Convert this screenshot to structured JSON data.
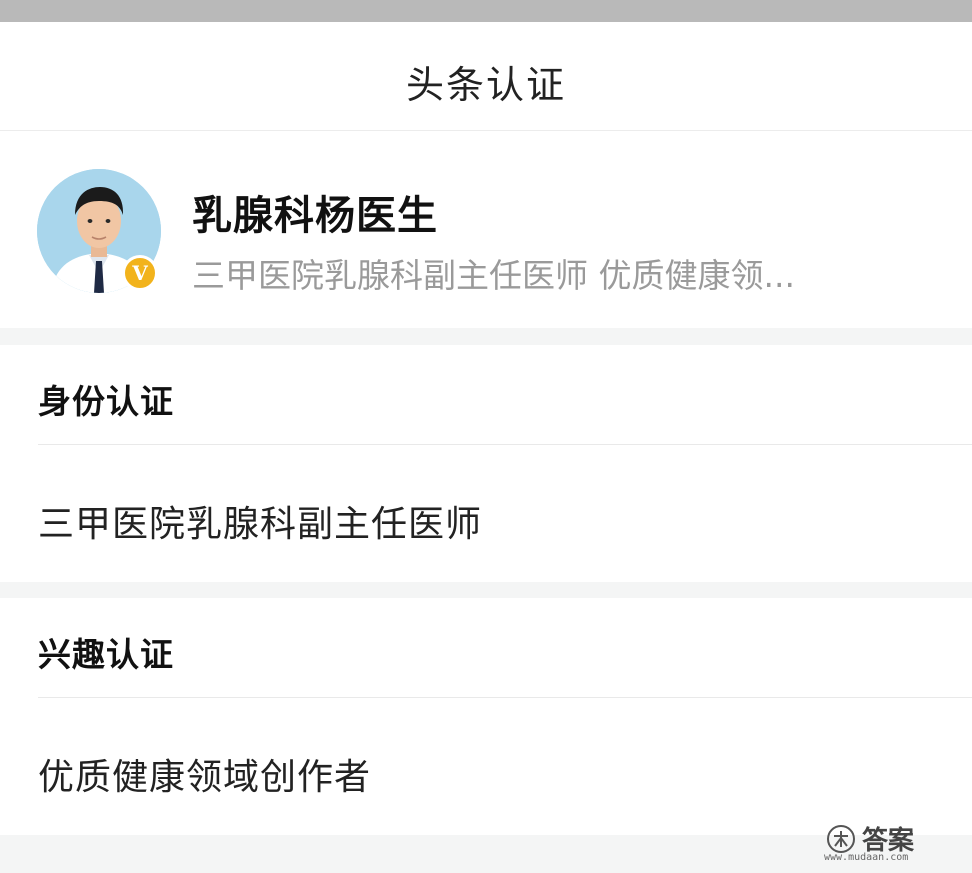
{
  "header": {
    "title": "头条认证"
  },
  "profile": {
    "name": "乳腺科杨医生",
    "description": "三甲医院乳腺科副主任医师 优质健康领...",
    "badge": "V"
  },
  "sections": [
    {
      "heading": "身份认证",
      "value": "三甲医院乳腺科副主任医师"
    },
    {
      "heading": "兴趣认证",
      "value": "优质健康领域创作者"
    }
  ],
  "watermark": {
    "text": "答案",
    "url": "www.mudaan.com"
  },
  "colors": {
    "badge": "#f2b31c",
    "secondary_text": "#9a9a9a",
    "page_background": "#f4f5f5"
  }
}
